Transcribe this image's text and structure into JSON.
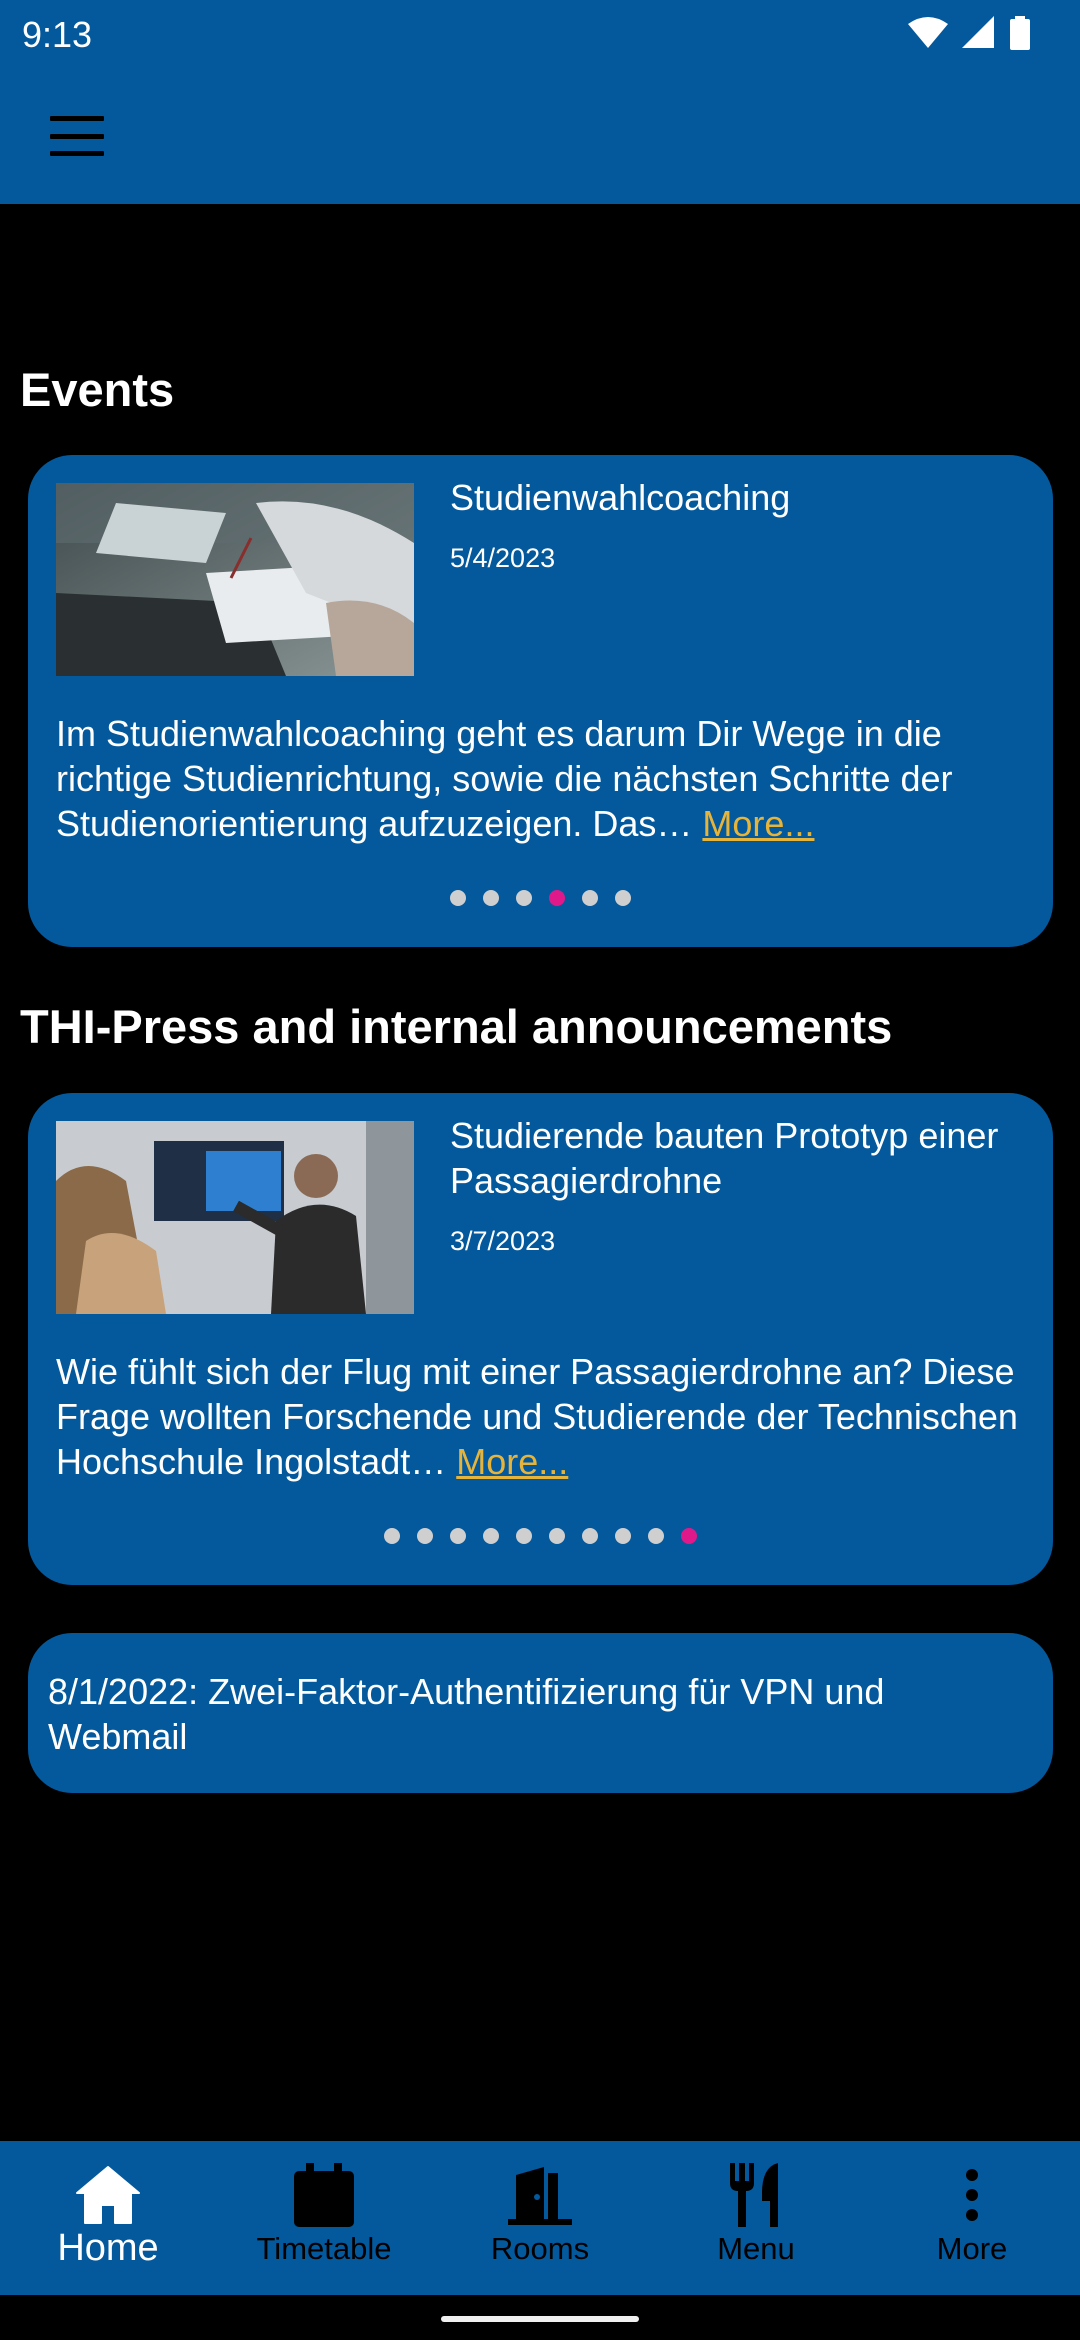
{
  "status_bar": {
    "time": "9:13"
  },
  "sections": {
    "events_title": "Events",
    "press_title": "THI-Press and internal announcements"
  },
  "events_card": {
    "title": "Studienwahlcoaching",
    "date": "5/4/2023",
    "body": "Im Studienwahlcoaching geht es darum Dir Wege in die richtige Studienrichtung, sowie die nächsten Schritte der Studienorientierung aufzuzeigen. Das…",
    "more_label": "More...",
    "dot_count": 6,
    "active_dot": 4
  },
  "press_card": {
    "title": "Studierende bauten Prototyp einer Passagierdrohne",
    "date": "3/7/2023",
    "body": "Wie fühlt sich der Flug mit einer Passagierdrohne an? Diese Frage wollten Forschende und Studierende der Technischen Hochschule Ingolstadt…",
    "more_label": "More...",
    "dot_count": 10,
    "active_dot": 10
  },
  "announcement": {
    "text": "8/1/2022: Zwei-Faktor-Authentifizierung für VPN und Webmail"
  },
  "bottom_nav": {
    "items": [
      {
        "label": "Home",
        "icon": "home-icon",
        "active": true
      },
      {
        "label": "Timetable",
        "icon": "calendar-icon",
        "active": false
      },
      {
        "label": "Rooms",
        "icon": "door-icon",
        "active": false
      },
      {
        "label": "Menu",
        "icon": "restaurant-icon",
        "active": false
      },
      {
        "label": "More",
        "icon": "more-vert-icon",
        "active": false
      }
    ]
  },
  "colors": {
    "primary": "#03599c",
    "background": "#000000",
    "link": "#e6b43a",
    "active_dot": "#e0198a"
  }
}
